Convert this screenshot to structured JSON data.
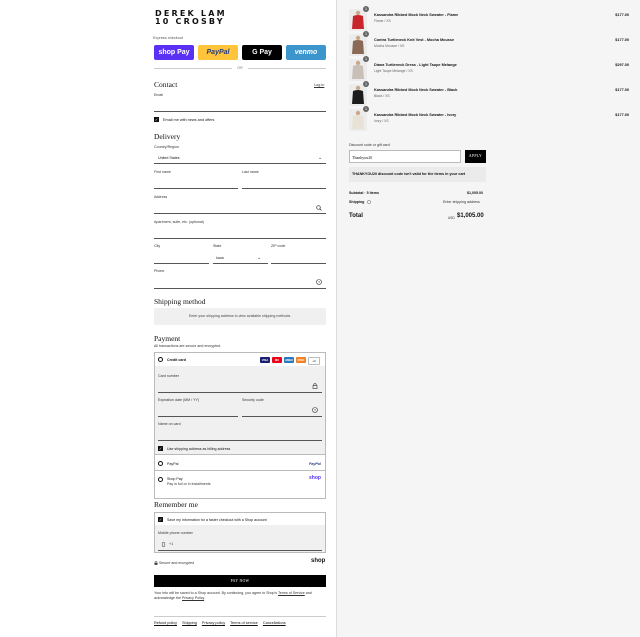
{
  "brand": {
    "line1": "DEREK LAM",
    "line2": "10 CROSBY"
  },
  "express": {
    "title": "Express checkout",
    "or": "OR",
    "shop_pay": "shop Pay",
    "paypal": "PayPal",
    "gpay": "G Pay",
    "venmo": "venmo"
  },
  "contact": {
    "heading": "Contact",
    "login": "Log in",
    "email_label": "Email",
    "news_label": "Email me with news and offers"
  },
  "delivery": {
    "heading": "Delivery",
    "country_label": "Country/Region",
    "country_value": "United States",
    "first_name": "First name",
    "last_name": "Last name",
    "address": "Address",
    "apartment": "Apartment, suite, etc. (optional)",
    "city": "City",
    "state_label": "State",
    "state_value": "Iowa",
    "zip": "ZIP code",
    "phone": "Phone"
  },
  "shipping": {
    "heading": "Shipping method",
    "message": "Enter your shipping address to view available shipping methods."
  },
  "payment": {
    "heading": "Payment",
    "subtitle": "All transactions are secure and encrypted.",
    "credit_card": "Credit card",
    "card_number": "Card number",
    "expiration": "Expiration date (MM / YY)",
    "security": "Security code",
    "name_on_card": "Name on card",
    "use_shipping": "Use shipping address as billing address",
    "paypal": "PayPal",
    "shop_pay": "Shop Pay",
    "shop_pay_sub": "Pay in full or in installments",
    "paypal_logo": "PayPal",
    "shop_logo": "shop",
    "card_logos": [
      "VISA",
      "MC",
      "AMEX",
      "DISC",
      "+4"
    ]
  },
  "remember": {
    "heading": "Remember me",
    "save_info": "Save my information for a faster checkout with a Shop account",
    "mobile_label": "Mobile phone number",
    "mobile_prefix": "+1",
    "secure": "Secure and encrypted",
    "shop_logo": "shop"
  },
  "pay_now": "PAY NOW",
  "legal": {
    "text": "Your info will be saved to a Shop account. By continuing, you agree to Shop's",
    "terms": "Terms of Service",
    "and": "and acknowledge the",
    "privacy": "Privacy Policy",
    "end": "."
  },
  "footer_links": [
    "Refund policy",
    "Shipping",
    "Privacy policy",
    "Terms of service",
    "Cancellations"
  ],
  "cart": {
    "items": [
      {
        "qty": "1",
        "name": "Kassandra Ribbed Mock Neck Sweater - Flame",
        "variant": "Flame / XS",
        "price": "$177.00",
        "color": "#c8262b"
      },
      {
        "qty": "1",
        "name": "Contra Turtleneck Knit Vest - Mocha Mousse",
        "variant": "Mocha Mousse / XS",
        "price": "$177.00",
        "color": "#8a6a55"
      },
      {
        "qty": "1",
        "name": "Diana Turtleneck Dress - Light Taupe Melange",
        "variant": "Light Taupe Melange / XS",
        "price": "$297.00",
        "color": "#c8bfb6"
      },
      {
        "qty": "1",
        "name": "Kassandra Ribbed Mock Neck Sweater - Black",
        "variant": "Black / XS",
        "price": "$177.00",
        "color": "#1c1c1c"
      },
      {
        "qty": "1",
        "name": "Kassandra Ribbed Mock Neck Sweater - Ivory",
        "variant": "Ivory / XS",
        "price": "$177.00",
        "color": "#e8e2d6"
      }
    ],
    "discount_label": "Discount code or gift card",
    "discount_value": "Thankyou20",
    "apply": "APPLY",
    "error": "THANKYOU20 discount code isn't valid for the items in your cart",
    "subtotal_label": "Subtotal · 5 items",
    "subtotal": "$1,005.00",
    "shipping_label": "Shipping",
    "shipping_value": "Enter shipping address",
    "total_label": "Total",
    "currency": "USD",
    "total": "$1,005.00"
  }
}
